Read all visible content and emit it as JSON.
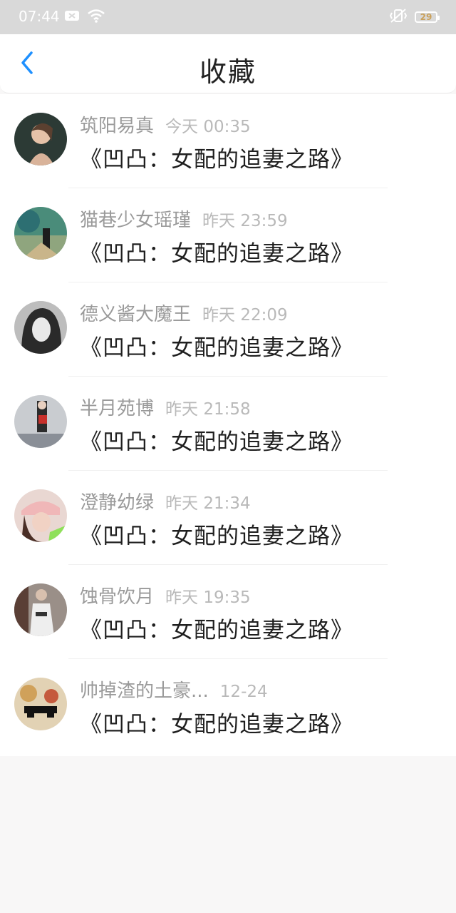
{
  "statusbar": {
    "time": "07:44",
    "battery": "29",
    "icons": [
      "message-icon",
      "wifi-icon",
      "vibrate-icon",
      "battery-icon"
    ]
  },
  "header": {
    "title": "收藏",
    "back_icon": "chevron-left-icon",
    "accent": "#1e90ff"
  },
  "items": [
    {
      "name": "筑阳易真",
      "time": "今天 00:35",
      "book": "《凹凸：女配的追妻之路》"
    },
    {
      "name": "猫巷少女瑶瑾",
      "time": "昨天 23:59",
      "book": "《凹凸：女配的追妻之路》"
    },
    {
      "name": "德义酱大魔王",
      "time": "昨天 22:09",
      "book": "《凹凸：女配的追妻之路》"
    },
    {
      "name": "半月苑博",
      "time": "昨天 21:58",
      "book": "《凹凸：女配的追妻之路》"
    },
    {
      "name": "澄静幼绿",
      "time": "昨天 21:34",
      "book": "《凹凸：女配的追妻之路》"
    },
    {
      "name": "蚀骨饮月",
      "time": "昨天 19:35",
      "book": "《凹凸：女配的追妻之路》"
    },
    {
      "name": "帅掉渣的土豪...",
      "time": "12-24",
      "book": "《凹凸：女配的追妻之路》"
    }
  ]
}
